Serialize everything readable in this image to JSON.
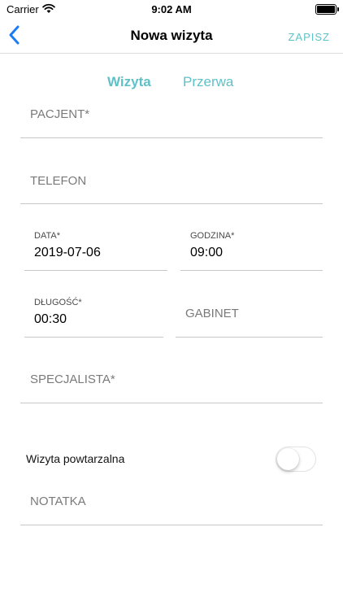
{
  "status_bar": {
    "carrier": "Carrier",
    "time": "9:02 AM"
  },
  "nav": {
    "title": "Nowa wizyta",
    "save_label": "ZAPISZ"
  },
  "tabs": [
    {
      "label": "Wizyta",
      "active": true
    },
    {
      "label": "Przerwa",
      "active": false
    }
  ],
  "form": {
    "patient_placeholder": "PACJENT*",
    "phone_placeholder": "TELEFON",
    "date": {
      "label": "DATA*",
      "value": "2019-07-06"
    },
    "time": {
      "label": "GODZINA*",
      "value": "09:00"
    },
    "duration": {
      "label": "DŁUGOŚĆ*",
      "value": "00:30"
    },
    "room_placeholder": "GABINET",
    "specialist_placeholder": "SPECJALISTA*",
    "recurring": {
      "label": "Wizyta powtarzalna",
      "enabled": false
    },
    "note_placeholder": "NOTATKA"
  },
  "colors": {
    "accent": "#5fc1c8",
    "back": "#1e7cf2",
    "divider": "#c8c8c8"
  },
  "icons": {
    "back": "chevron-left-icon",
    "wifi": "wifi-icon",
    "battery": "battery-icon"
  }
}
